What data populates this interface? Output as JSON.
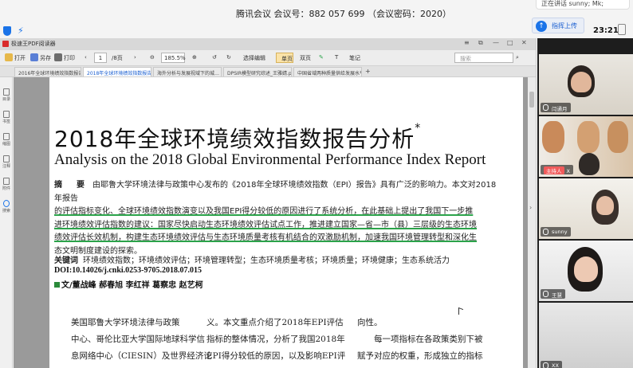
{
  "meeting": {
    "title": "腾讯会议 会议号：882 057 699 （会议密码：2020）",
    "chat_preview": "正在讲话 sunny; Mk;",
    "raise_hand_label": "指挥上传",
    "clock": "23:21"
  },
  "pdf_app": {
    "title": "极速王PDF阅读器",
    "toolbar": {
      "open": "打开",
      "save_as": "另存",
      "print": "打印",
      "page_current": "1",
      "page_total": "/8页",
      "zoom": "185.5%",
      "select_mode": "选择编辑",
      "single_page": "单页",
      "double_page": "双页",
      "annotate": "笔记",
      "search_placeholder": "搜索"
    },
    "tabs": [
      {
        "label": "2016年全球环境绩效指数报告…"
      },
      {
        "label": "2018年全球环境绩效指数报告分…",
        "active": true
      },
      {
        "label": "海外分析与发展视域下的城…"
      },
      {
        "label": "DPSIR模型研究综述_王雅婧.pdf"
      },
      {
        "label": "中国省域两种质量供给发展水平评…"
      }
    ],
    "sidebar": [
      {
        "label": "目录"
      },
      {
        "label": "书签"
      },
      {
        "label": "缩图"
      },
      {
        "label": "注释"
      },
      {
        "label": "附件"
      },
      {
        "label": "搜索"
      }
    ]
  },
  "paper": {
    "title": "2018年全球环境绩效指数报告分析",
    "title_mark": "*",
    "subtitle": "Analysis on the 2018 Global Environmental Performance Index Report",
    "abstract_label": "摘　要",
    "abstract_lines": [
      "由耶鲁大学环境法律与政策中心发布的《2018年全球环境绩效指数（EPI）报告》具有广泛的影响力。本文对2018年报告",
      "的评估指标变化、全球环境绩效指数演变以及我国EPI得分较低的原因进行了系统分析，在此基础上提出了我国下一步推",
      "进环境绩效评估指数的建议：国家尽快启动生态环境绩效评估试点工作，推进建立国家—省—市（县）三层级的生态环境",
      "绩效评估长效机制，构建生态环境绩效评估与生态环境质量考核有机结合的双激励机制，加速我国环境管理转型和深化生",
      "态文明制度建设的探索。"
    ],
    "keywords_label": "关键词",
    "keywords": "环境绩效指数；环境绩效评估；环境管理转型；生态环境质量考核；环境质量；环境健康；生态系统活力",
    "doi": "DOI:10.14026/j.cnki.0253-9705.2018.07.015",
    "authors": "文/董战峰 郝春旭 李红祥 葛察忠 赵艺柯",
    "body_col1": [
      "美国耶鲁大学环境法律与政策",
      "中心、哥伦比亚大学国际地球科学信",
      "息网络中心（CIESIN）及世界经济论"
    ],
    "body_col2": [
      "义。本文重点介绍了2018年EPI评估",
      "指标的整体情况，分析了我国2018年",
      "EPI得分较低的原因，以及影响EPI评"
    ],
    "body_col3": [
      "向性。",
      "　　每一项指标在各政策类别下被",
      "赋予对应的权重，形成独立的指标"
    ]
  },
  "participants": [
    {
      "name": "闫通月",
      "host": false
    },
    {
      "name": "X",
      "host": true,
      "host_label": "主持人"
    },
    {
      "name": "sunny",
      "host": false
    },
    {
      "name": "王慧",
      "host": false
    },
    {
      "name": "XX",
      "host": false
    }
  ]
}
